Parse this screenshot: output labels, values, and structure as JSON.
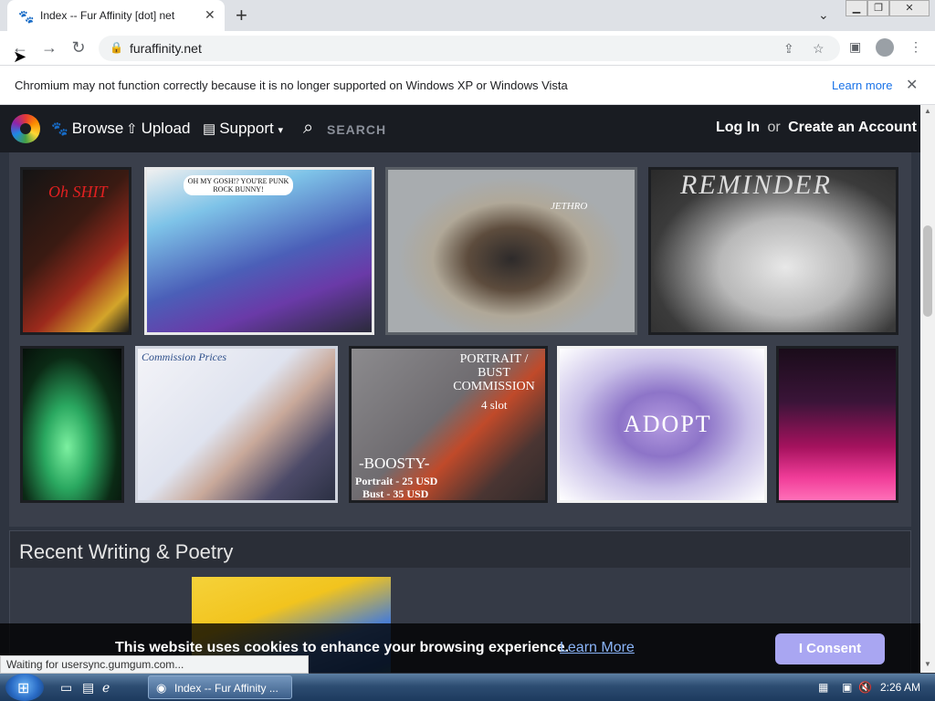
{
  "browser": {
    "tab_title": "Index -- Fur Affinity [dot] net",
    "tab_favicon": "paw-icon",
    "url": "furaffinity.net",
    "infobar_message": "Chromium may not function correctly because it is no longer supported on Windows XP or Windows Vista",
    "infobar_link": "Learn more"
  },
  "site_nav": {
    "browse": "Browse",
    "upload": "Upload",
    "support": "Support",
    "search_placeholder": "SEARCH",
    "login": "Log In",
    "or": "or",
    "create_account": "Create an Account"
  },
  "gallery": {
    "thumb_texts": {
      "shit": "Oh SHIT",
      "comic": "OH MY GOSH!? YOU'RE PUNK ROCK BUNNY!",
      "jethro": "JETHRO",
      "reminder": "REMINDER",
      "commission": "Commission Prices",
      "portrait_title": "PORTRAIT / BUST COMMISSION",
      "portrait_slots": "4 slot",
      "boosty": "-BOOSTY-",
      "portrait_price": "Portrait - 25 USD",
      "bust_price": "Bust - 35 USD",
      "adopt": "ADOPT"
    }
  },
  "writing_section": {
    "title": "Recent Writing & Poetry"
  },
  "cookie": {
    "message": "This website uses cookies to enhance your browsing experience.",
    "link": "Learn More",
    "button": "I Consent"
  },
  "status_bar": "Waiting for usersync.gumgum.com...",
  "taskbar": {
    "task_label": "Index -- Fur Affinity ...",
    "clock": "2:26 AM"
  }
}
